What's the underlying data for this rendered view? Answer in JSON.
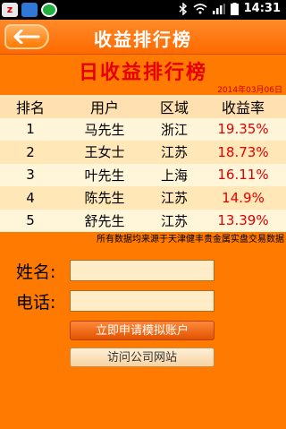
{
  "status": {
    "time": "14:31"
  },
  "header": {
    "title": "收益排行榜"
  },
  "main": {
    "subtitle": "日收益排行榜",
    "date": "2014年03月06日",
    "table": {
      "headers": [
        "排名",
        "用户",
        "区域",
        "收益率"
      ],
      "rows": [
        [
          "1",
          "马先生",
          "浙江",
          "19.35%"
        ],
        [
          "2",
          "王女士",
          "江苏",
          "18.73%"
        ],
        [
          "3",
          "叶先生",
          "上海",
          "16.11%"
        ],
        [
          "4",
          "陈先生",
          "江苏",
          "14.9%"
        ],
        [
          "5",
          "舒先生",
          "江苏",
          "13.39%"
        ]
      ]
    },
    "note": "所有数据均来源于天津健丰贵金属实盘交易数据",
    "form": {
      "name_label": "姓名:",
      "name_value": "",
      "phone_label": "电话:",
      "phone_value": "",
      "apply_button": "立即申请模拟账户",
      "visit_button": "访问公司网站"
    }
  },
  "colors": {
    "accent": "#ff7a00",
    "value_red": "#e00000"
  }
}
